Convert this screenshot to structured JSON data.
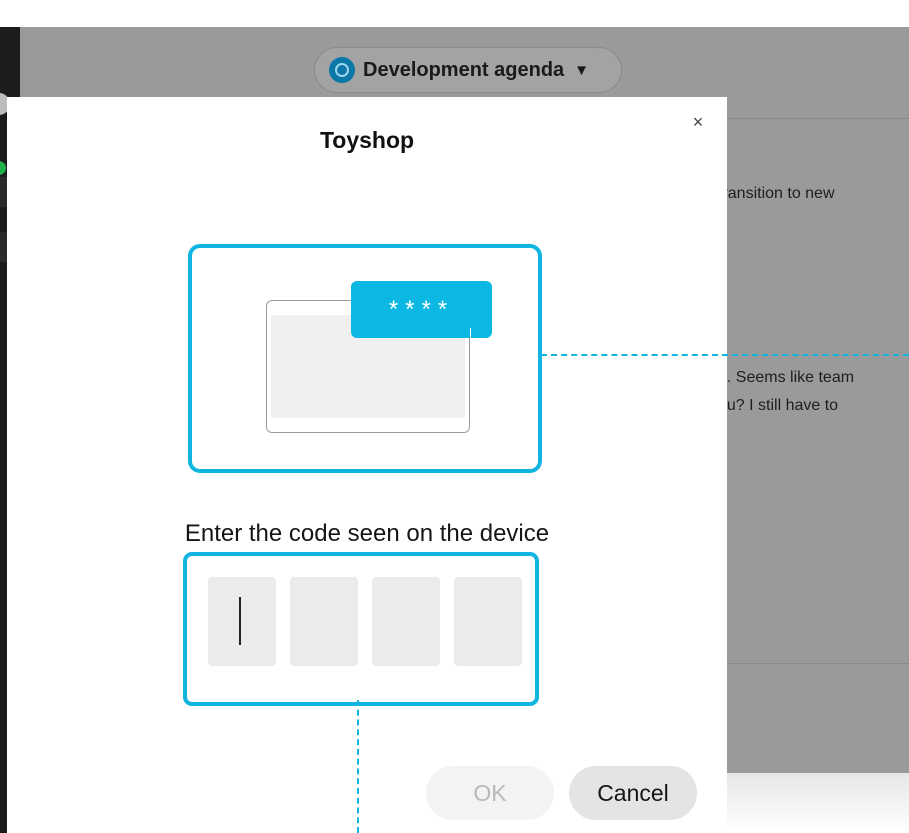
{
  "background_app": {
    "conversation_title": "Development agenda",
    "dropdown_glyph": "▼",
    "message_fragments": [
      "transition to new",
      "e. Seems like team",
      "ou? I still have to"
    ]
  },
  "dialog": {
    "title": "Toyshop",
    "close_glyph": "×",
    "device_code_display": "****",
    "prompt": "Enter the code seen on the device",
    "code_digits": [
      "",
      "",
      "",
      ""
    ],
    "ok_label": "OK",
    "ok_enabled": false,
    "cancel_label": "Cancel"
  },
  "icons": [
    "conversation-icon",
    "dropdown-caret-icon",
    "close-icon"
  ],
  "colors": {
    "accent": "#12b5e0",
    "badge": "#0bb8e3",
    "overlay": "#9a9a9a",
    "sidebar": "#1c1c1c"
  }
}
